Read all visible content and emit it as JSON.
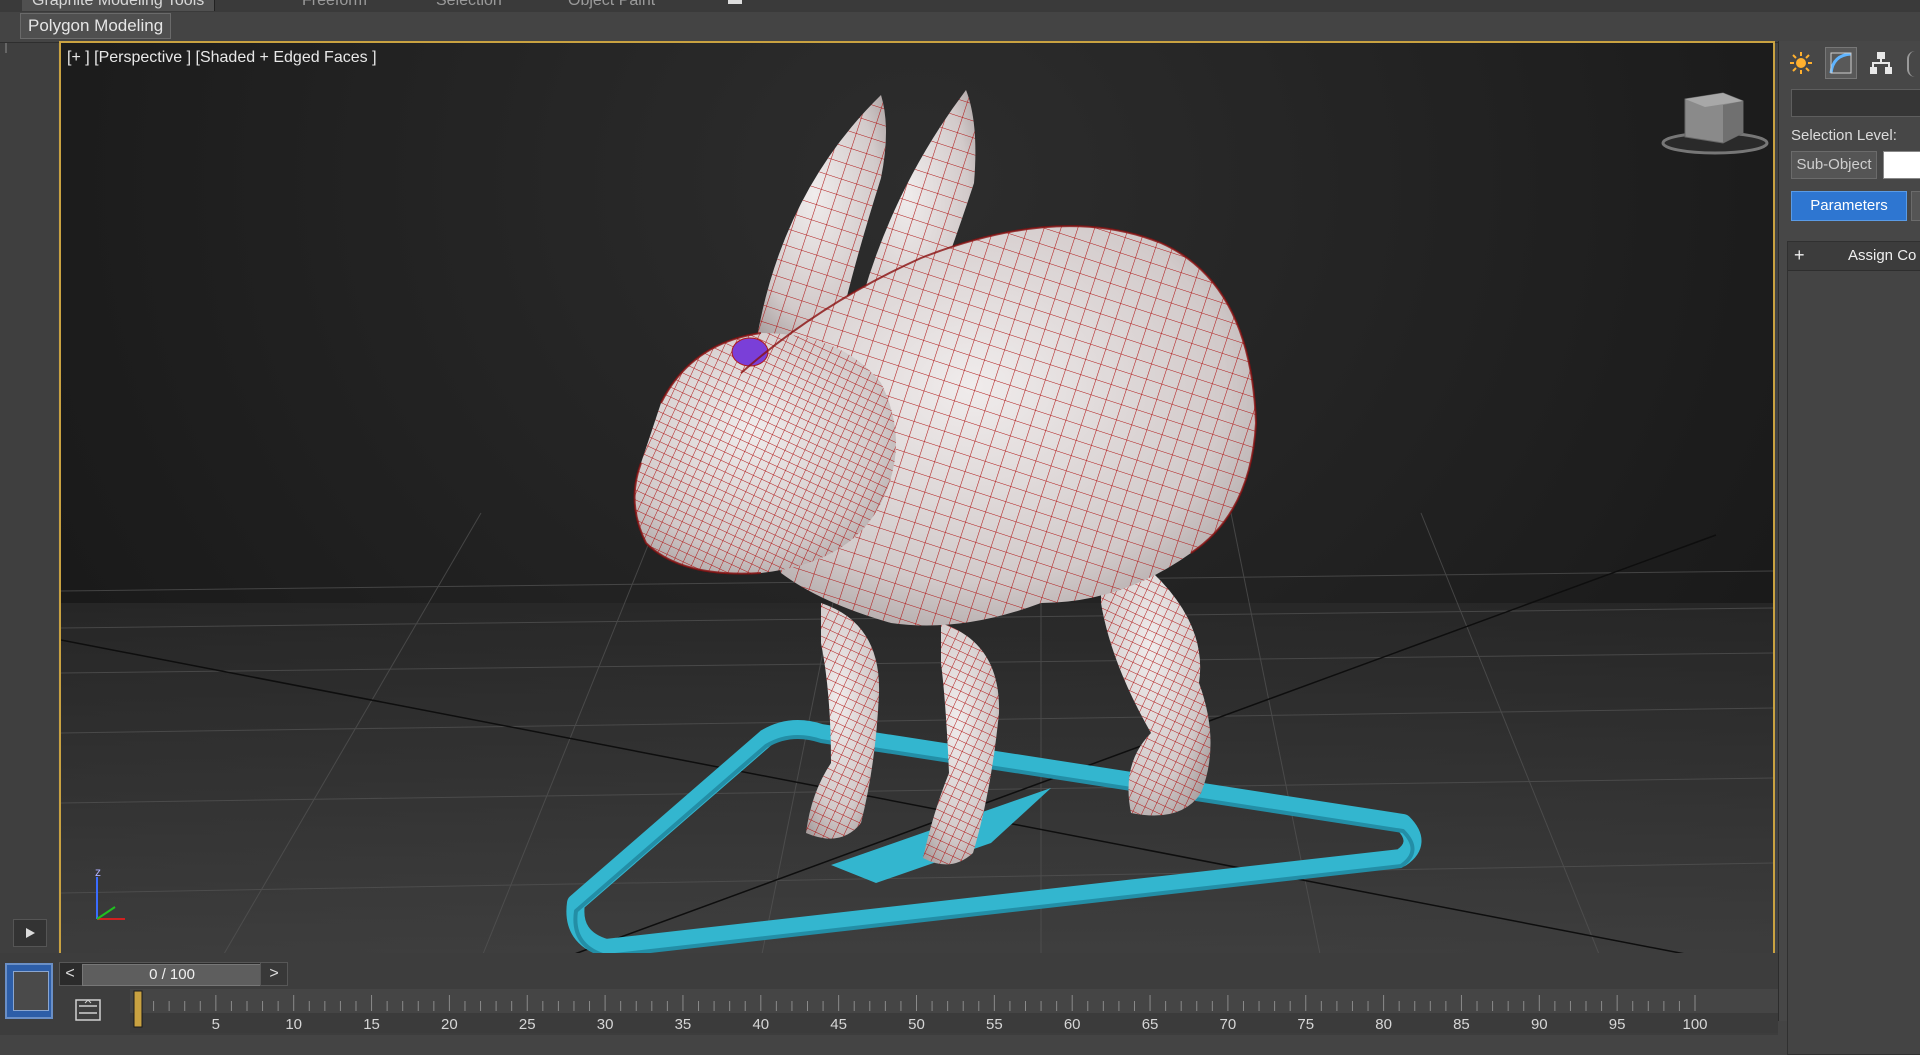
{
  "ribbon": {
    "tabs": [
      {
        "label": "Graphite Modeling Tools",
        "active": true
      },
      {
        "label": "Freeform",
        "active": false
      },
      {
        "label": "Selection",
        "active": false
      },
      {
        "label": "Object Paint",
        "active": false
      }
    ],
    "panel_label": "Polygon Modeling"
  },
  "viewport": {
    "label": "[+ ] [Perspective ] [Shaded + Edged Faces ]",
    "viewcube_icon": "viewcube-icon",
    "axis_icon": "axis-tripod-icon",
    "axis_z": "z",
    "object_color": "#e6dede",
    "wire_color": "#b01818",
    "eye_color": "#7a3fd8",
    "helper_color": "#33b6cf",
    "border_color": "#c9a241"
  },
  "command_panel": {
    "icons": [
      "sun-light-icon",
      "modify-curve-icon",
      "hierarchy-icon"
    ],
    "selection_level_label": "Selection Level:",
    "sub_object_label": "Sub-Object",
    "parameters_label": "Parameters",
    "rollout_toggle": "+",
    "rollout_title": "Assign Co"
  },
  "timeline": {
    "slider_prev": "<",
    "slider_value": "0 / 100",
    "slider_next": ">",
    "current_frame": 0,
    "start": 0,
    "end": 100,
    "tick_labels": [
      "5",
      "10",
      "15",
      "20",
      "25",
      "30",
      "35",
      "40",
      "45",
      "50",
      "55",
      "60",
      "65",
      "70",
      "75",
      "80",
      "85",
      "90",
      "95",
      "100"
    ]
  },
  "left_strip": {
    "play_icon": "play-icon"
  }
}
